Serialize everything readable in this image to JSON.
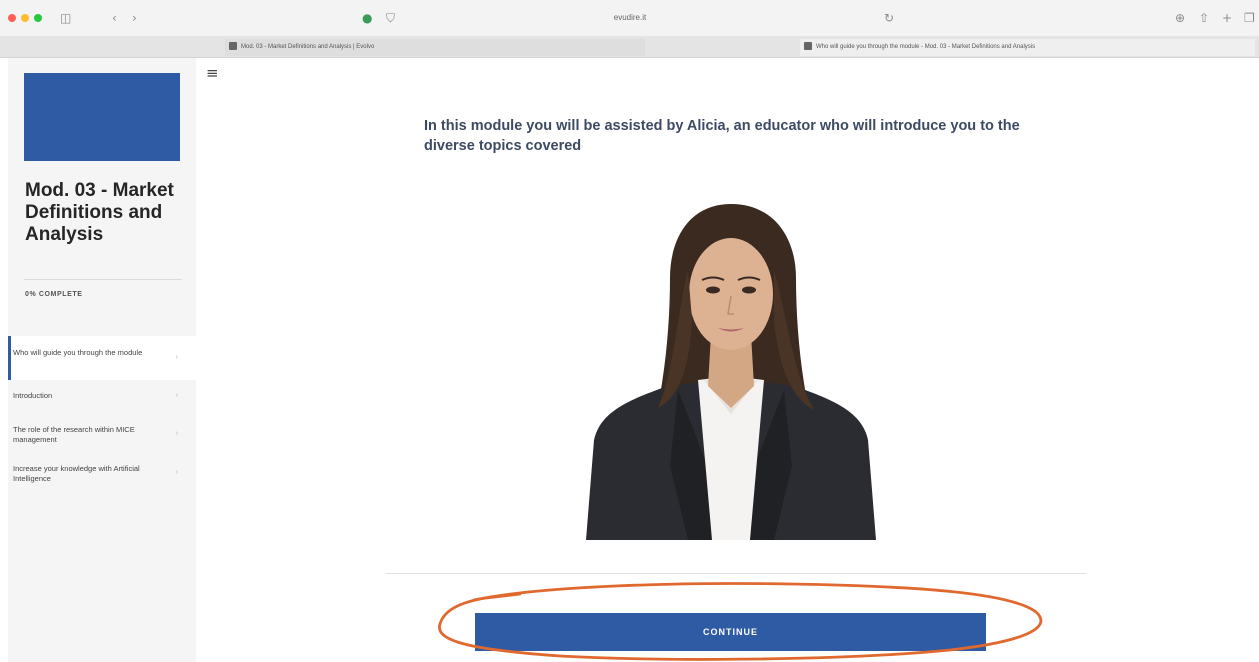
{
  "colors": {
    "accent": "#2f5ba4",
    "annotation": "#e0692f"
  },
  "browser": {
    "address": "evudire.it",
    "tabs": [
      {
        "label": "Mod. 03 - Market Definitions and Analysis | Evolvo"
      },
      {
        "label": "Who will guide you through the module - Mod. 03 - Market Definitions and Analysis"
      }
    ]
  },
  "sidebar": {
    "course_title": "Mod. 03 - Market Definitions and Analysis",
    "progress_text": "0% COMPLETE",
    "progress_percent": 0,
    "lessons": [
      {
        "label": "Who will guide you through the module",
        "active": true
      },
      {
        "label": "Introduction",
        "active": false
      },
      {
        "label": "The role of the research within MICE management",
        "active": false
      },
      {
        "label": "Increase your knowledge with Artificial Intelligence",
        "active": false
      }
    ]
  },
  "main": {
    "intro_text": "In this module you will be assisted by Alicia, an educator who will introduce you to the diverse topics covered",
    "continue_label": "CONTINUE"
  }
}
